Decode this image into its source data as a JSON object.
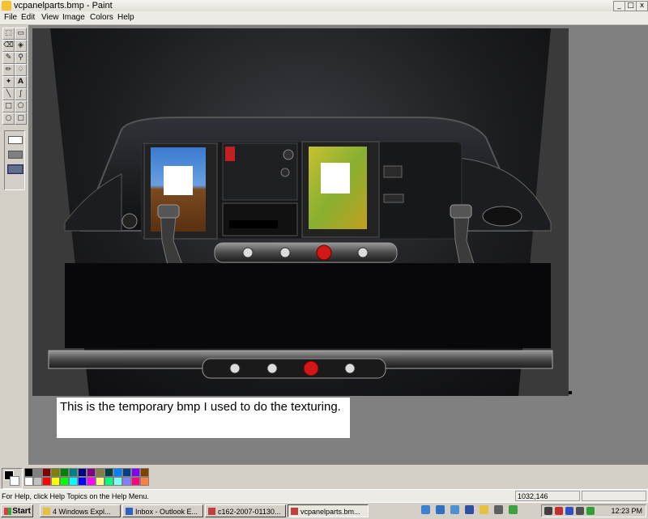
{
  "window": {
    "title": "vcpanelparts.bmp - Paint",
    "controls": {
      "minimize": "_",
      "maximize": "□",
      "close": "x"
    }
  },
  "menu": [
    "File",
    "Edit",
    "View",
    "Image",
    "Colors",
    "Help"
  ],
  "tools": [
    {
      "icon": "free-select-icon",
      "glyph": "⬚"
    },
    {
      "icon": "rect-select-icon",
      "glyph": "▭"
    },
    {
      "icon": "eraser-icon",
      "glyph": "⌫"
    },
    {
      "icon": "fill-bucket-icon",
      "glyph": "◈"
    },
    {
      "icon": "color-picker-icon",
      "glyph": "✎"
    },
    {
      "icon": "magnifier-icon",
      "glyph": "⚲"
    },
    {
      "icon": "pencil-icon",
      "glyph": "✏"
    },
    {
      "icon": "brush-icon",
      "glyph": "♢"
    },
    {
      "icon": "airbrush-icon",
      "glyph": "✦"
    },
    {
      "icon": "text-icon",
      "glyph": "A"
    },
    {
      "icon": "line-icon",
      "glyph": "╲"
    },
    {
      "icon": "curve-icon",
      "glyph": "∫"
    },
    {
      "icon": "rectangle-icon",
      "glyph": "□"
    },
    {
      "icon": "polygon-icon",
      "glyph": "⬠"
    },
    {
      "icon": "ellipse-icon",
      "glyph": "○"
    },
    {
      "icon": "rounded-rect-icon",
      "glyph": "▢"
    }
  ],
  "caption": {
    "text": "This is the temporary bmp I used to do the texturing."
  },
  "palette": {
    "top_row": [
      "#000000",
      "#808080",
      "#800000",
      "#808000",
      "#008000",
      "#008080",
      "#000080",
      "#800080",
      "#808040",
      "#004040",
      "#0080ff",
      "#004080",
      "#8000ff",
      "#804000"
    ],
    "bottom_row": [
      "#ffffff",
      "#c0c0c0",
      "#ff0000",
      "#ffff00",
      "#00ff00",
      "#00ffff",
      "#0000ff",
      "#ff00ff",
      "#ffff80",
      "#00ff80",
      "#80ffff",
      "#8080ff",
      "#ff0080",
      "#ff8040"
    ],
    "foreground": "#000000",
    "background": "#ffffff"
  },
  "status": {
    "help": "For Help, click Help Topics on the Help Menu.",
    "coords": "1032,146"
  },
  "taskbar": {
    "start": "Start",
    "tasks": [
      {
        "label": "4 Windows Expl...",
        "icon": "folder-icon",
        "color": "#e8c040"
      },
      {
        "label": "Inbox - Outlook E...",
        "icon": "outlook-icon",
        "color": "#3060c0"
      },
      {
        "label": "c162-2007-01130...",
        "icon": "paint-icon",
        "color": "#c04040"
      },
      {
        "label": "vcpanelparts.bm...",
        "icon": "paint-icon",
        "color": "#c04040"
      }
    ],
    "clock": "12:23 PM"
  }
}
